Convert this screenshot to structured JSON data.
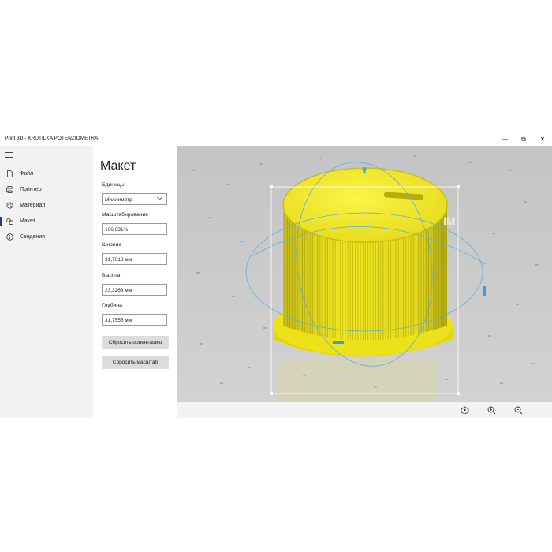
{
  "window": {
    "title": "Print 3D - KRUTILKA POTENZIOMETRA",
    "controls": {
      "minimize": "—",
      "restore": "⧉",
      "close": "✕"
    }
  },
  "nav": {
    "items": [
      {
        "label": "Файл",
        "icon": "file-icon"
      },
      {
        "label": "Принтер",
        "icon": "printer-icon"
      },
      {
        "label": "Материал",
        "icon": "material-icon"
      },
      {
        "label": "Макет",
        "icon": "layout-icon",
        "active": true
      },
      {
        "label": "Сведения",
        "icon": "info-icon"
      }
    ]
  },
  "panel": {
    "title": "Макет",
    "units_label": "Единицы",
    "units_value": "Миллиметр",
    "scale_label": "Масштабирование",
    "scale_value": "106,031%",
    "width_label": "Ширина",
    "width_value": "31,7018 мм",
    "height_label": "Высота",
    "height_value": "23,3268 мм",
    "depth_label": "Глубина",
    "depth_value": "31,7555 мм",
    "reset_orientation": "Сбросить ориентацию",
    "reset_scale": "Сбросить масштаб"
  },
  "toolbar": {
    "more": "…",
    "icons": [
      "view-3d-icon",
      "zoom-in-icon",
      "zoom-out-icon",
      "more-icon"
    ]
  },
  "colors": {
    "model_yellow": "#f0e61e",
    "gizmo_blue": "#5aaee8",
    "active_nav": "#1f3d70"
  }
}
